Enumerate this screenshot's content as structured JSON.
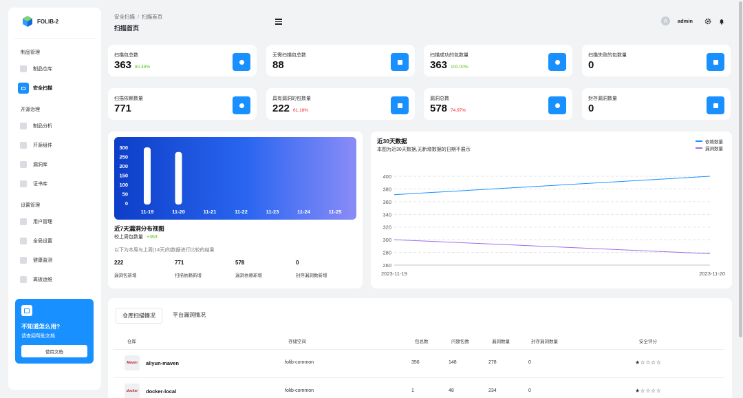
{
  "app": {
    "name": "FOLIB-2"
  },
  "sidebar": {
    "sections": [
      {
        "title": "制品管理",
        "items": [
          {
            "label": "制品仓库",
            "icon": "warehouse-icon",
            "active": false
          },
          {
            "label": "安全扫描",
            "icon": "scan-icon",
            "active": true
          }
        ]
      },
      {
        "title": "开源治理",
        "items": [
          {
            "label": "制品分析",
            "icon": "analysis-icon",
            "active": false
          },
          {
            "label": "开源组件",
            "icon": "component-icon",
            "active": false
          },
          {
            "label": "漏洞库",
            "icon": "vulnerability-icon",
            "active": false
          },
          {
            "label": "证书库",
            "icon": "certificate-icon",
            "active": false
          }
        ]
      },
      {
        "title": "设置管理",
        "items": [
          {
            "label": "用户管理",
            "icon": "user-icon",
            "active": false
          },
          {
            "label": "全局设置",
            "icon": "wrench-icon",
            "active": false
          },
          {
            "label": "健康监测",
            "icon": "monitor-icon",
            "active": false
          },
          {
            "label": "离板运维",
            "icon": "ops-icon",
            "active": false
          }
        ]
      }
    ],
    "help": {
      "title": "不知道怎么用?",
      "subtitle": "请查阅帮助文档",
      "button": "使用文档"
    }
  },
  "header": {
    "breadcrumb": [
      "安全扫描",
      "扫描首页"
    ],
    "title": "扫描首页",
    "avatar_letter": "A",
    "user": "admin"
  },
  "stats": [
    {
      "label": "扫描包总数",
      "value": "363",
      "pct": "80.49%",
      "pct_color": "green"
    },
    {
      "label": "无需扫描包总数",
      "value": "88",
      "pct": "",
      "pct_color": ""
    },
    {
      "label": "扫描成功的包数量",
      "value": "363",
      "pct": "100.00%",
      "pct_color": "green"
    },
    {
      "label": "扫描失败的包数量",
      "value": "0",
      "pct": "",
      "pct_color": ""
    },
    {
      "label": "扫描依赖数量",
      "value": "771",
      "pct": "",
      "pct_color": ""
    },
    {
      "label": "具有漏洞的包数量",
      "value": "222",
      "pct": "61.16%",
      "pct_color": "red"
    },
    {
      "label": "漏洞总数",
      "value": "578",
      "pct": "74.97%",
      "pct_color": "red"
    },
    {
      "label": "封存漏洞数量",
      "value": "0",
      "pct": "",
      "pct_color": ""
    }
  ],
  "weekly": {
    "title": "近7天漏洞分布视图",
    "compare_label": "较上周包数量",
    "compare_value": "+363",
    "description": "以下为本周与上周(14天)的数据进行比较的结果",
    "mini": [
      {
        "value": "222",
        "label": "漏洞包新增"
      },
      {
        "value": "771",
        "label": "扫描依赖新增"
      },
      {
        "value": "578",
        "label": "漏洞依赖新增"
      },
      {
        "value": "0",
        "label": "封存漏洞数新增"
      }
    ]
  },
  "monthly": {
    "title": "近30天数据",
    "subtitle": "本图为近30天数据,无新增数据的日期不展示"
  },
  "chart_data": [
    {
      "type": "bar",
      "categories": [
        "11-19",
        "11-20",
        "11-21",
        "11-22",
        "11-23",
        "11-24",
        "11-25"
      ],
      "values": [
        300,
        275,
        0,
        0,
        0,
        0,
        0
      ],
      "ylim": [
        0,
        300
      ],
      "yticks": [
        0,
        50,
        100,
        150,
        200,
        250,
        300
      ],
      "grid": false,
      "legend": "none"
    },
    {
      "type": "line",
      "x": [
        "2023-11-19",
        "2023-11-20"
      ],
      "series": [
        {
          "name": "依赖数量",
          "values": [
            371,
            400
          ],
          "color": "#1890ff"
        },
        {
          "name": "漏洞数量",
          "values": [
            300,
            278
          ],
          "color": "#9b6ee8"
        }
      ],
      "ylim": [
        260,
        400
      ],
      "yticks": [
        260,
        280,
        300,
        320,
        340,
        360,
        380,
        400
      ],
      "grid": true,
      "legend": "top-right"
    }
  ],
  "table": {
    "tabs": [
      "仓库扫描情况",
      "平台漏洞情况"
    ],
    "columns": [
      "仓库",
      "存储空间",
      "包总数",
      "问题包数",
      "漏洞数量",
      "封存漏洞数量",
      "安全评分"
    ],
    "rows": [
      {
        "logo": "Maven",
        "repo": "aliyun-maven",
        "storage": "folib-common",
        "total": "356",
        "problem": "148",
        "vulns": "278",
        "sealed": "0",
        "stars": "★☆☆☆☆"
      },
      {
        "logo": "docker",
        "repo": "docker-local",
        "storage": "folib-common",
        "total": "1",
        "problem": "48",
        "vulns": "234",
        "sealed": "0",
        "stars": "★☆☆☆☆"
      }
    ]
  }
}
